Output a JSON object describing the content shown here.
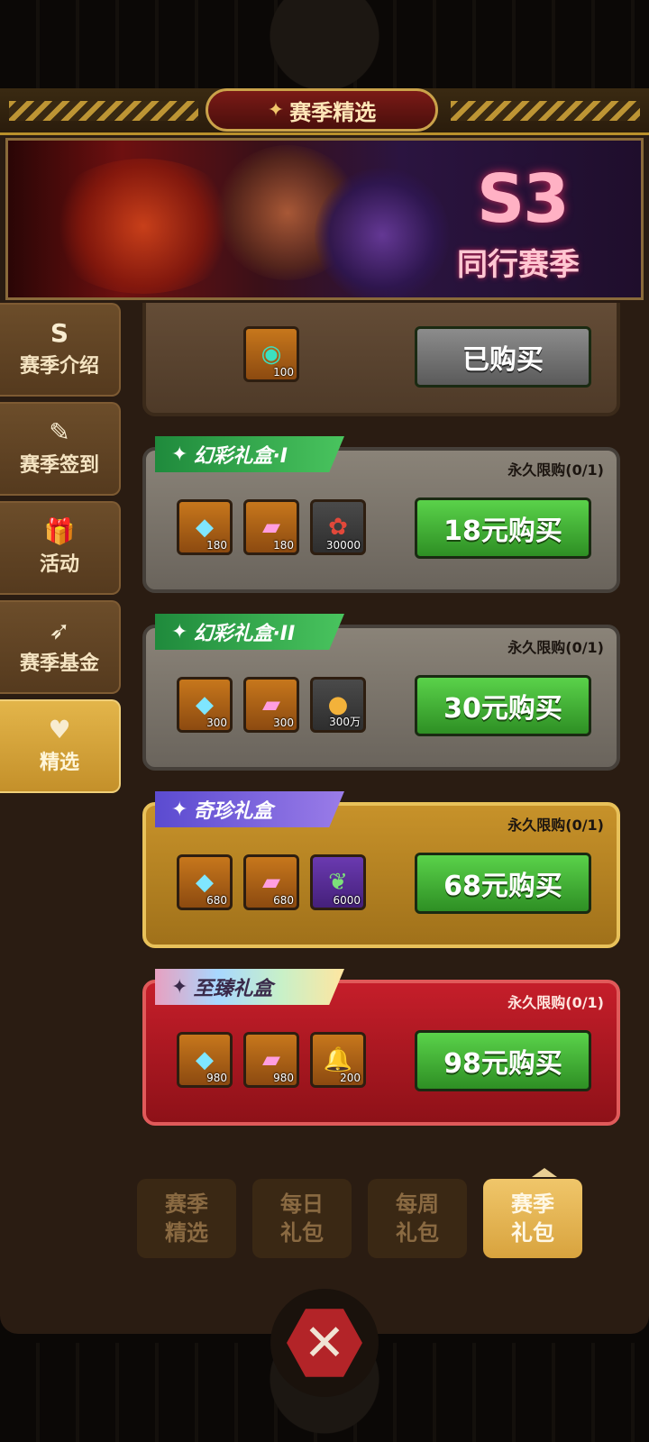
{
  "header": {
    "title": "赛季精选",
    "title_icon": "sparkle-icon"
  },
  "banner": {
    "season_code": "S3",
    "season_name": "同行赛季"
  },
  "sidebar": {
    "items": [
      {
        "label": "赛季介绍",
        "icon": "s-badge-icon",
        "glyph": "S",
        "active": false
      },
      {
        "label": "赛季签到",
        "icon": "quill-icon",
        "glyph": "✎",
        "active": false
      },
      {
        "label": "活动",
        "icon": "gift-icon",
        "glyph": "🎁",
        "active": false
      },
      {
        "label": "赛季基金",
        "icon": "wing-icon",
        "glyph": "➶",
        "active": false
      },
      {
        "label": "精选",
        "icon": "heart-icon",
        "glyph": "♥",
        "active": true
      }
    ]
  },
  "packages": [
    {
      "name": "",
      "limit": "",
      "items": [
        {
          "icon": "token-icon",
          "glyph": "◉",
          "qty": "100"
        }
      ],
      "button": "已购买"
    },
    {
      "name": "幻彩礼盒·I",
      "limit": "永久限购(0/1)",
      "items": [
        {
          "icon": "gem-icon",
          "glyph": "◆",
          "qty": "180"
        },
        {
          "icon": "card-icon",
          "glyph": "▰",
          "qty": "180"
        },
        {
          "icon": "flower-icon",
          "glyph": "✿",
          "qty": "30000"
        }
      ],
      "button": "18元购买"
    },
    {
      "name": "幻彩礼盒·II",
      "limit": "永久限购(0/1)",
      "items": [
        {
          "icon": "gem-icon",
          "glyph": "◆",
          "qty": "300"
        },
        {
          "icon": "card-icon",
          "glyph": "▰",
          "qty": "300"
        },
        {
          "icon": "coin-icon",
          "glyph": "●",
          "qty": "300万"
        }
      ],
      "button": "30元购买"
    },
    {
      "name": "奇珍礼盒",
      "limit": "永久限购(0/1)",
      "items": [
        {
          "icon": "gem-icon",
          "glyph": "◆",
          "qty": "680"
        },
        {
          "icon": "card-icon",
          "glyph": "▰",
          "qty": "680"
        },
        {
          "icon": "leaf-icon",
          "glyph": "❦",
          "qty": "6000"
        }
      ],
      "button": "68元购买"
    },
    {
      "name": "至臻礼盒",
      "limit": "永久限购(0/1)",
      "items": [
        {
          "icon": "gem-icon",
          "glyph": "◆",
          "qty": "980"
        },
        {
          "icon": "card-icon",
          "glyph": "▰",
          "qty": "980"
        },
        {
          "icon": "bell-icon",
          "glyph": "🔔",
          "qty": "200"
        }
      ],
      "button": "98元购买"
    }
  ],
  "bottom_tabs": [
    {
      "label": "赛季\n精选",
      "active": false
    },
    {
      "label": "每日\n礼包",
      "active": false
    },
    {
      "label": "每周\n礼包",
      "active": false
    },
    {
      "label": "赛季\n礼包",
      "active": true
    }
  ],
  "close": {
    "glyph": "✕",
    "icon": "close-icon"
  }
}
